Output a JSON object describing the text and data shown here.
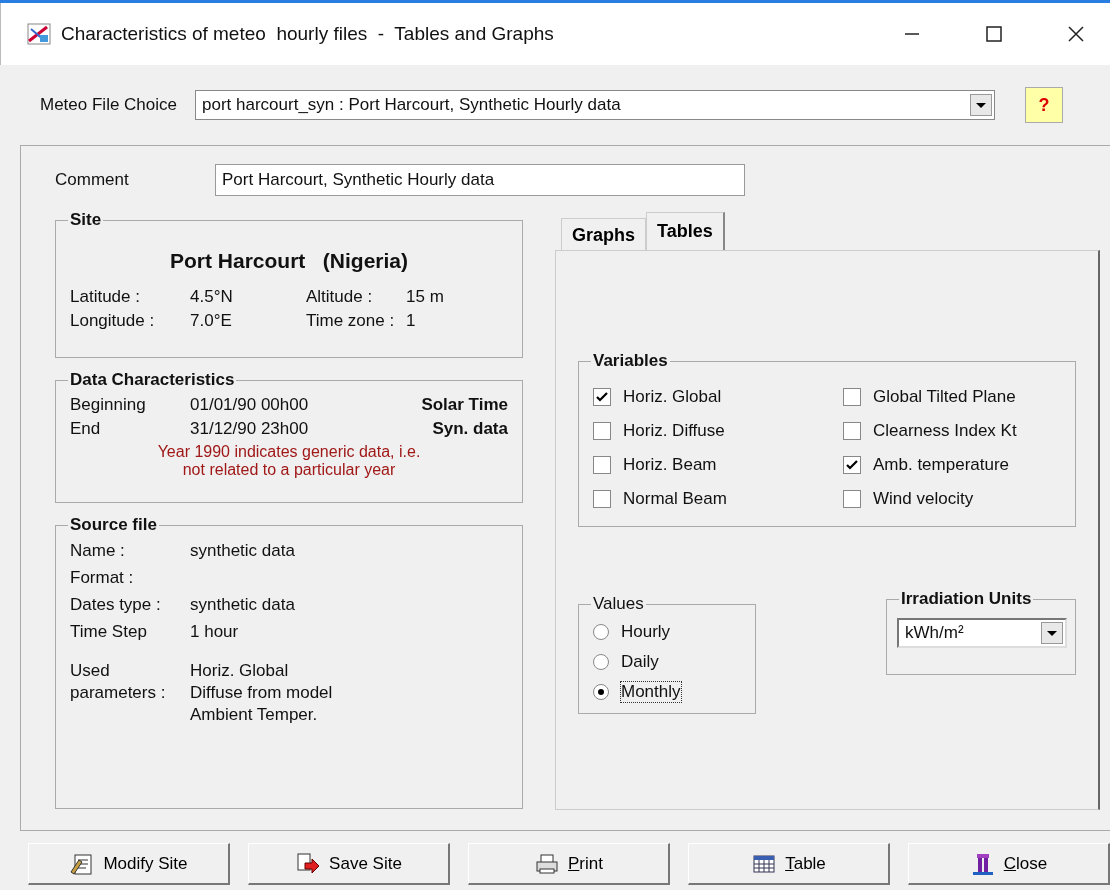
{
  "window": {
    "title": "Characteristics of meteo  hourly files  -  Tables and Graphs"
  },
  "meteo_file": {
    "label": "Meteo File Choice",
    "value": "port harcourt_syn : Port Harcourt, Synthetic Hourly data",
    "help": "?"
  },
  "comment": {
    "label": "Comment",
    "value": "Port Harcourt, Synthetic Hourly data"
  },
  "site": {
    "title": "Site",
    "name": "Port Harcourt   (Nigeria)",
    "fields": [
      {
        "label": "Latitude :",
        "value": "4.5°N"
      },
      {
        "label": "Altitude :",
        "value": "15 m"
      },
      {
        "label": "Longitude :",
        "value": "7.0°E"
      },
      {
        "label": "Time zone :",
        "value": "1"
      }
    ]
  },
  "data_characteristics": {
    "title": "Data Characteristics",
    "rows": [
      {
        "label": "Beginning",
        "value": "01/01/90 00h00",
        "note": "Solar Time"
      },
      {
        "label": "End",
        "value": "31/12/90 23h00",
        "note": "Syn. data"
      }
    ],
    "warning": [
      "Year 1990 indicates generic data, i.e.",
      "not related to a particular year"
    ]
  },
  "source_file": {
    "title": "Source file",
    "rows": [
      {
        "label": "Name :",
        "values": [
          "synthetic data"
        ]
      },
      {
        "label": "Format :",
        "values": []
      },
      {
        "label": "Dates type :",
        "values": [
          "synthetic data"
        ]
      },
      {
        "label": "Time Step",
        "values": [
          "1 hour"
        ]
      },
      {
        "label": "Used parameters :",
        "values": [
          "Horiz. Global",
          "Diffuse from model",
          "Ambient Temper."
        ]
      }
    ]
  },
  "tabs": [
    {
      "label": "Graphs",
      "selected": false
    },
    {
      "label": "Tables",
      "selected": true
    }
  ],
  "variables": {
    "title": "Variables",
    "items": [
      {
        "label": "Horiz. Global",
        "checked": true
      },
      {
        "label": "Horiz. Diffuse",
        "checked": false
      },
      {
        "label": "Horiz. Beam",
        "checked": false
      },
      {
        "label": "Normal Beam",
        "checked": false
      },
      {
        "label": "Global Tilted Plane",
        "checked": false
      },
      {
        "label": "Clearness Index Kt",
        "checked": false
      },
      {
        "label": "Amb. temperature",
        "checked": true
      },
      {
        "label": "Wind velocity",
        "checked": false
      }
    ]
  },
  "values": {
    "title": "Values",
    "options": [
      {
        "label": "Hourly",
        "selected": false
      },
      {
        "label": "Daily",
        "selected": false
      },
      {
        "label": "Monthly",
        "selected": true
      }
    ]
  },
  "irradiation_units": {
    "title": "Irradiation Units",
    "value": "kWh/m²"
  },
  "buttons": [
    {
      "kind": "modify",
      "label": "Modify Site"
    },
    {
      "kind": "save",
      "label": "Save Site"
    },
    {
      "kind": "print",
      "label": "Print"
    },
    {
      "kind": "table",
      "label": "Table"
    },
    {
      "kind": "close",
      "label": "Close"
    }
  ]
}
